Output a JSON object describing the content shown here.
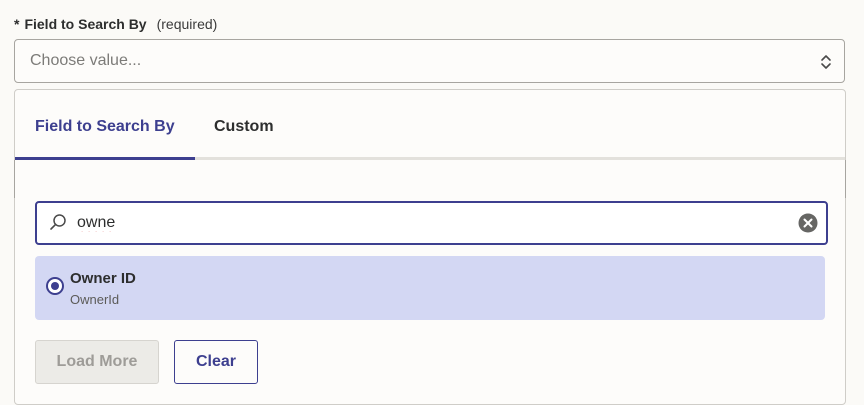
{
  "field": {
    "required_marker": "*",
    "label": "Field to Search By",
    "required_note": "(required)",
    "select_placeholder": "Choose value...",
    "select_icon": "chevron-up-down-icon"
  },
  "dropdown": {
    "tabs": [
      {
        "label": "Field to Search By",
        "active": true
      },
      {
        "label": "Custom",
        "active": false
      }
    ],
    "search": {
      "value": "owne",
      "icon": "search-icon",
      "clear_icon": "clear-circle-icon"
    },
    "options": [
      {
        "title": "Owner ID",
        "subtitle": "OwnerId",
        "selected": true
      }
    ],
    "buttons": {
      "load_more": "Load More",
      "clear": "Clear"
    }
  },
  "colors": {
    "accent": "#3d3f8f",
    "selected_row": "#d3d7f3",
    "background": "#fbfaf7",
    "disabled_button": "#ecebe7"
  }
}
